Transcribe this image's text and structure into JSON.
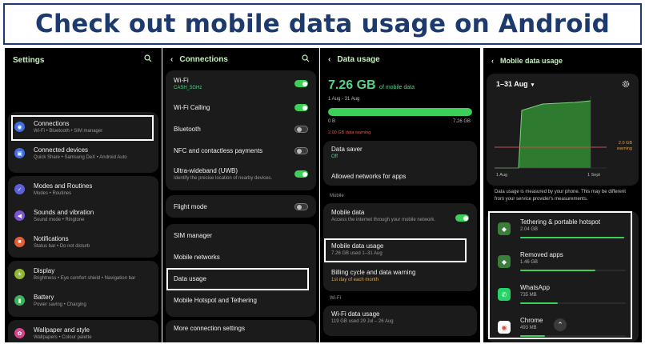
{
  "banner": {
    "title": "Check out mobile data usage on Android"
  },
  "settings": {
    "title": "Settings",
    "items": [
      {
        "label": "Connections",
        "sub": "Wi-Fi • Bluetooth • SIM manager"
      },
      {
        "label": "Connected devices",
        "sub": "Quick Share • Samsung DeX • Android Auto"
      },
      {
        "label": "Modes and Routines",
        "sub": "Modes • Routines"
      },
      {
        "label": "Sounds and vibration",
        "sub": "Sound mode • Ringtone"
      },
      {
        "label": "Notifications",
        "sub": "Status bar • Do not disturb"
      },
      {
        "label": "Display",
        "sub": "Brightness • Eye comfort shield • Navigation bar"
      },
      {
        "label": "Battery",
        "sub": "Power saving • Charging"
      },
      {
        "label": "Wallpaper and style",
        "sub": "Wallpapers • Colour palette"
      }
    ]
  },
  "connections": {
    "title": "Connections",
    "wifi": {
      "label": "Wi-Fi",
      "sub": "CASH_5GHz"
    },
    "wifi_calling": "Wi-Fi Calling",
    "bluetooth": "Bluetooth",
    "nfc": "NFC and contactless payments",
    "uwb": {
      "label": "Ultra-wideband (UWB)",
      "sub": "Identify the precise location of nearby devices."
    },
    "flight_mode": "Flight mode",
    "sim_manager": "SIM manager",
    "mobile_networks": "Mobile networks",
    "data_usage": "Data usage",
    "hotspot": "Mobile Hotspot and Tethering",
    "more": "More connection settings"
  },
  "data_usage": {
    "title": "Data usage",
    "amount": "7.26 GB",
    "amount_suffix": "of mobile data",
    "period": "1 Aug - 31 Aug",
    "progress": 1.0,
    "scale_start": "0 B",
    "scale_end": "7.26 GB",
    "warning": "2.00 GB data warning",
    "data_saver": {
      "label": "Data saver",
      "sub": "Off"
    },
    "allowed_networks": "Allowed networks for apps",
    "mobile_section": "Mobile",
    "mobile_data": {
      "label": "Mobile data",
      "sub": "Access the internet through your mobile network."
    },
    "mobile_data_usage": {
      "label": "Mobile data usage",
      "sub": "7.26 GB used 1–31 Aug"
    },
    "billing": {
      "label": "Billing cycle and data warning",
      "sub": "1st day of each month"
    },
    "wifi_section": "Wi-Fi",
    "wifi_usage": {
      "label": "Wi-Fi data usage",
      "sub": "119 GB used 29 Jul – 26 Aug"
    }
  },
  "mobile_data_usage": {
    "title": "Mobile data usage",
    "period": "1–31 Aug",
    "warning_label_1": "2.0 GB",
    "warning_label_2": "warning",
    "x_start": "1 Aug",
    "x_end": "1 Sept",
    "note": "Data usage is measured by your phone. This may be different from your service provider's measurements.",
    "apps": [
      {
        "name": "Tethering & portable hotspot",
        "usage": "2.04 GB",
        "fraction": 1.0,
        "icon": "android-icon",
        "color": "#3b7d3b"
      },
      {
        "name": "Removed apps",
        "usage": "1.46 GB",
        "fraction": 0.72,
        "icon": "android-icon",
        "color": "#3b7d3b"
      },
      {
        "name": "WhatsApp",
        "usage": "735 MB",
        "fraction": 0.36,
        "icon": "whatsapp-icon",
        "color": "#25d366"
      },
      {
        "name": "Chrome",
        "usage": "493 MB",
        "fraction": 0.24,
        "icon": "chrome-icon",
        "color": "#ffffff"
      }
    ]
  },
  "colors": {
    "banner": "#1c3a6e",
    "accent_green": "#3ccf5a",
    "warning_line": "#c0504d"
  }
}
